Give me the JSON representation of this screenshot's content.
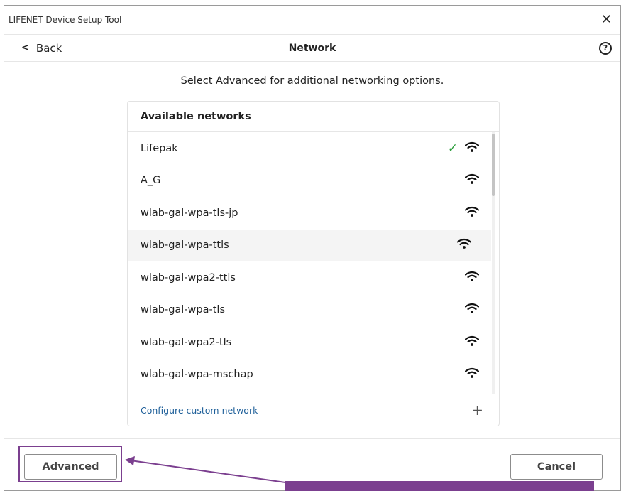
{
  "window": {
    "title": "LIFENET Device Setup Tool",
    "close_icon": "close-icon"
  },
  "navbar": {
    "back_label": "Back",
    "title": "Network",
    "help_glyph": "?"
  },
  "intro_text": "Select Advanced for additional networking options.",
  "panel": {
    "header": "Available networks",
    "networks": [
      {
        "name": "Lifepak",
        "connected": true
      },
      {
        "name": "A_G",
        "connected": false
      },
      {
        "name": "wlab-gal-wpa-tls-jp",
        "connected": false
      },
      {
        "name": "wlab-gal-wpa-ttls",
        "connected": false,
        "hovered": true
      },
      {
        "name": "wlab-gal-wpa2-ttls",
        "connected": false
      },
      {
        "name": "wlab-gal-wpa-tls",
        "connected": false
      },
      {
        "name": "wlab-gal-wpa2-tls",
        "connected": false
      },
      {
        "name": "wlab-gal-wpa-mschap",
        "connected": false
      }
    ],
    "custom_link": "Configure custom network",
    "plus_glyph": "+"
  },
  "buttons": {
    "advanced": "Advanced",
    "cancel": "Cancel"
  },
  "colors": {
    "annotation": "#7b3f8f",
    "check": "#2a9d3a",
    "link": "#1e5f99"
  }
}
